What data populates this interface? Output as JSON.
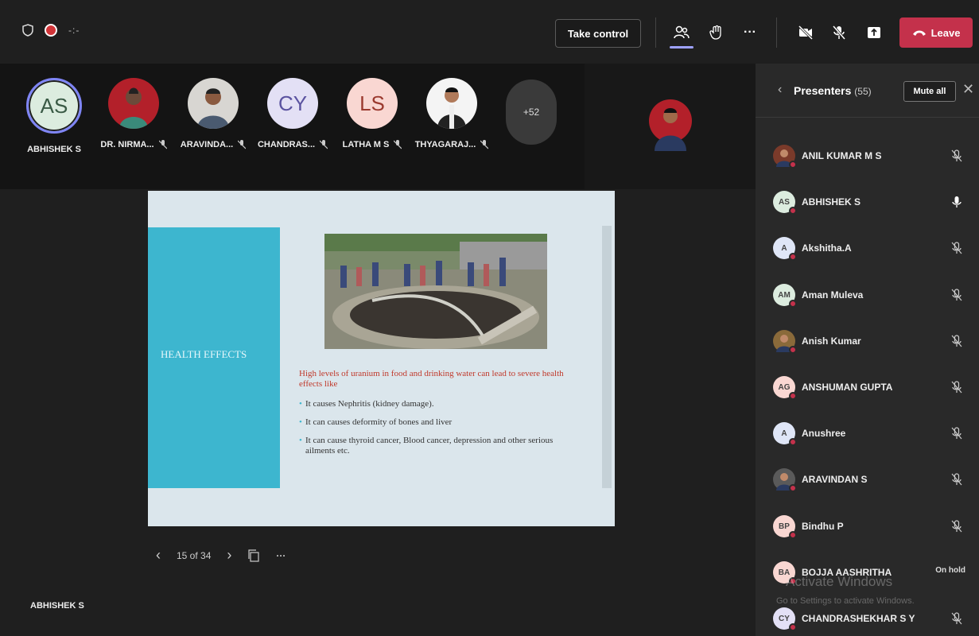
{
  "toolbar": {
    "take_control_label": "Take control",
    "leave_label": "Leave",
    "more_label": "···"
  },
  "gallery": {
    "participants": [
      {
        "initials": "AS",
        "name": "ABHISHEK S",
        "bg": "#dcecdf",
        "fg": "#3a5a45",
        "photo": false
      },
      {
        "initials": "",
        "name": "DR. NIRMA...",
        "bg": "#b3202a",
        "fg": "#fff",
        "photo": true
      },
      {
        "initials": "",
        "name": "ARAVINDA...",
        "bg": "#d8d6d2",
        "fg": "#333",
        "photo": true
      },
      {
        "initials": "CY",
        "name": "CHANDRAS...",
        "bg": "#e3e0f5",
        "fg": "#5b53a0",
        "photo": false
      },
      {
        "initials": "LS",
        "name": "LATHA M S",
        "bg": "#f9d7d2",
        "fg": "#9b3a2f",
        "photo": false
      },
      {
        "initials": "",
        "name": "THYAGARAJ...",
        "bg": "#f4f4f4",
        "fg": "#333",
        "photo": true
      }
    ],
    "more_count": "+52"
  },
  "slide": {
    "left_title": "HEALTH EFFECTS",
    "heading": "High levels of uranium in food and drinking water can lead to severe health effects like",
    "bullets": [
      "It causes Nephritis (kidney damage).",
      "It can causes deformity of bones and liver",
      "It can cause thyroid cancer, Blood cancer, depression and other serious ailments etc."
    ]
  },
  "slide_nav": {
    "position": "15 of 34",
    "more": "···"
  },
  "presenter_label": "ABHISHEK S",
  "panel": {
    "title": "Presenters",
    "count": "(55)",
    "mute_all": "Mute all",
    "people": [
      {
        "initials": "",
        "name": "ANIL KUMAR M S",
        "bg": "#7a3a2a",
        "photo": true,
        "mic": "off",
        "status": ""
      },
      {
        "initials": "AS",
        "name": "ABHISHEK S",
        "bg": "#dcecdf",
        "photo": false,
        "mic": "on",
        "status": ""
      },
      {
        "initials": "A",
        "name": "Akshitha.A",
        "bg": "#dfe6f7",
        "photo": false,
        "mic": "off",
        "status": ""
      },
      {
        "initials": "AM",
        "name": "Aman Muleva",
        "bg": "#dcecdf",
        "photo": false,
        "mic": "off",
        "status": ""
      },
      {
        "initials": "",
        "name": "Anish Kumar",
        "bg": "#8a6a3a",
        "photo": true,
        "mic": "off",
        "status": ""
      },
      {
        "initials": "AG",
        "name": "ANSHUMAN GUPTA",
        "bg": "#f9d7d2",
        "photo": false,
        "mic": "off",
        "status": ""
      },
      {
        "initials": "A",
        "name": "Anushree",
        "bg": "#dfe6f7",
        "photo": false,
        "mic": "off",
        "status": ""
      },
      {
        "initials": "",
        "name": "ARAVINDAN S",
        "bg": "#5a5a5a",
        "photo": true,
        "mic": "off",
        "status": ""
      },
      {
        "initials": "BP",
        "name": "Bindhu P",
        "bg": "#f9d7d2",
        "photo": false,
        "mic": "off",
        "status": ""
      },
      {
        "initials": "BA",
        "name": "BOJJA AASHRITHA",
        "bg": "#f9d7d2",
        "photo": false,
        "mic": "none",
        "status": "On hold"
      },
      {
        "initials": "CY",
        "name": "CHANDRASHEKHAR S Y",
        "bg": "#e3e0f5",
        "photo": false,
        "mic": "off",
        "status": ""
      }
    ]
  },
  "watermark": {
    "line1": "Activate Windows",
    "line2": "Go to Settings to activate Windows."
  }
}
